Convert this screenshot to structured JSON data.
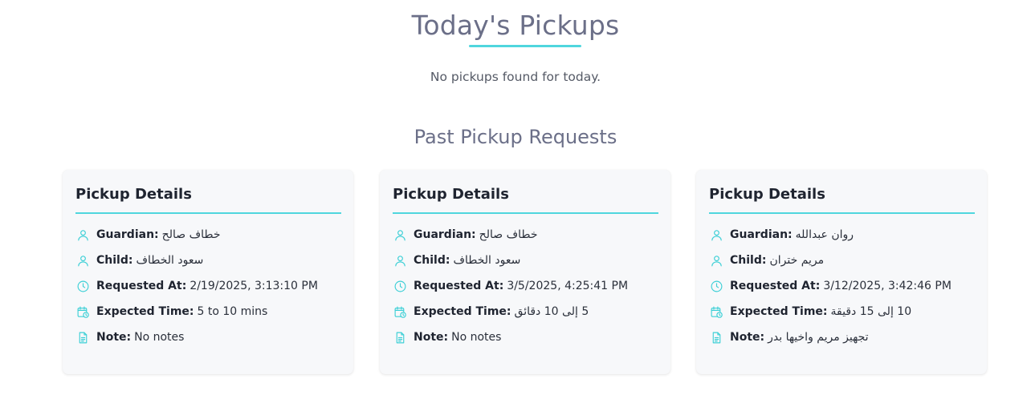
{
  "header": {
    "title": "Today's Pickups",
    "empty_message": "No pickups found for today."
  },
  "past": {
    "heading": "Past Pickup Requests"
  },
  "labels": {
    "guardian": "Guardian:",
    "child": "Child:",
    "requested_at": "Requested At:",
    "expected_time": "Expected Time:",
    "note": "Note:"
  },
  "cards": [
    {
      "title": "Pickup Details",
      "guardian": "خطاف صالح",
      "child": "سعود الخطاف",
      "requested_at": "2/19/2025, 3:13:10 PM",
      "expected_time": "5 to 10 mins",
      "note": "No notes"
    },
    {
      "title": "Pickup Details",
      "guardian": "خطاف صالح",
      "child": "سعود الخطاف",
      "requested_at": "3/5/2025, 4:25:41 PM",
      "expected_time": "5 إلى 10 دقائق",
      "note": "No notes"
    },
    {
      "title": "Pickup Details",
      "guardian": "روان عبدالله",
      "child": "مريم ختران",
      "requested_at": "3/12/2025, 3:42:46 PM",
      "expected_time": "10 إلى 15 دقيقة",
      "note": "تجهيز مريم واخيها بدر"
    }
  ],
  "colors": {
    "accent": "#4fd6de",
    "icon": "#3ccfd6",
    "heading": "#6b6f88",
    "card_bg": "#f7f8fa"
  },
  "icons": {
    "guardian": "user-icon",
    "child": "user-icon",
    "requested_at": "clock-icon",
    "expected_time": "calendar-clock-icon",
    "note": "document-icon"
  }
}
